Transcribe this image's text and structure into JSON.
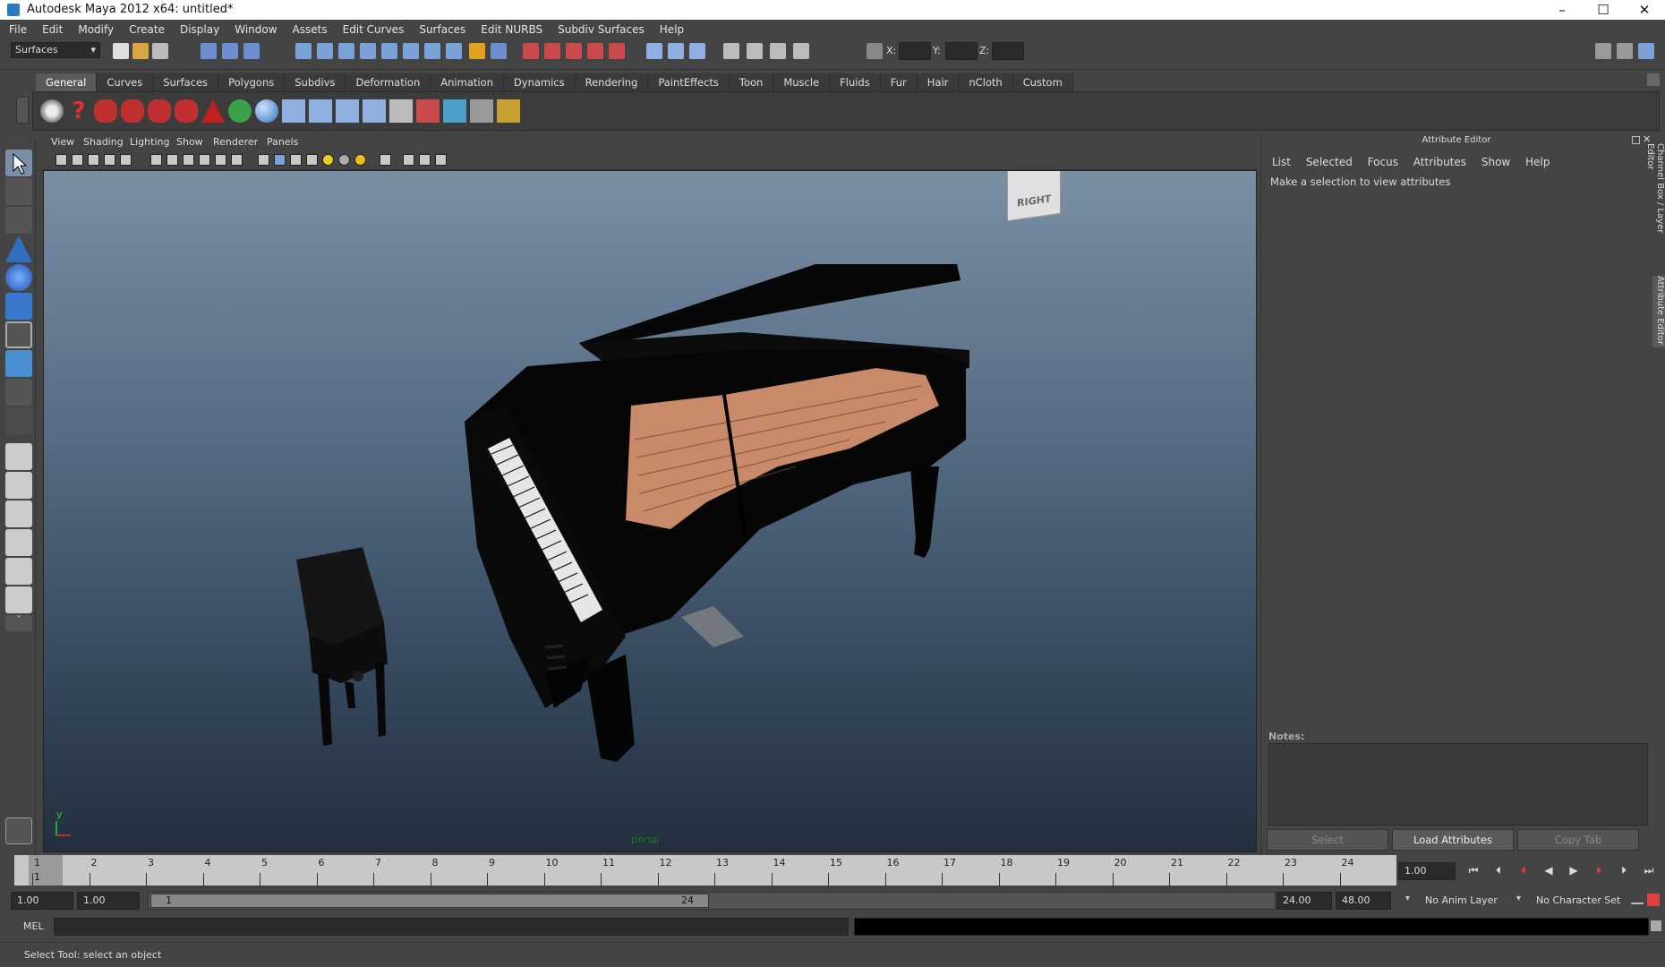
{
  "window": {
    "title": "Autodesk Maya 2012 x64: untitled*"
  },
  "menubar": [
    "File",
    "Edit",
    "Modify",
    "Create",
    "Display",
    "Window",
    "Assets",
    "Edit Curves",
    "Surfaces",
    "Edit NURBS",
    "Subdiv Surfaces",
    "Help"
  ],
  "statusline": {
    "menu_set": "Surfaces",
    "x_label": "X:",
    "y_label": "Y:",
    "z_label": "Z:"
  },
  "shelf": {
    "tabs": [
      "General",
      "Curves",
      "Surfaces",
      "Polygons",
      "Subdivs",
      "Deformation",
      "Animation",
      "Dynamics",
      "Rendering",
      "PaintEffects",
      "Toon",
      "Muscle",
      "Fluids",
      "Fur",
      "Hair",
      "nCloth",
      "Custom"
    ],
    "active_tab": "General"
  },
  "panel": {
    "menus": [
      "View",
      "Shading",
      "Lighting",
      "Show",
      "Renderer",
      "Panels"
    ],
    "camera_label": "persp",
    "viewcube_label": "RIGHT",
    "axis_y": "y"
  },
  "attribute_editor": {
    "title": "Attribute Editor",
    "menus": [
      "List",
      "Selected",
      "Focus",
      "Attributes",
      "Show",
      "Help"
    ],
    "hint": "Make a selection to view attributes",
    "notes_label": "Notes:",
    "buttons": {
      "select": "Select",
      "load": "Load Attributes",
      "copy": "Copy Tab"
    },
    "side_tabs": [
      "Channel Box / Layer Editor",
      "Attribute Editor"
    ]
  },
  "timeslider": {
    "ticks": [
      "1",
      "2",
      "3",
      "4",
      "5",
      "6",
      "7",
      "8",
      "9",
      "10",
      "11",
      "12",
      "13",
      "14",
      "15",
      "16",
      "17",
      "18",
      "19",
      "20",
      "21",
      "22",
      "23",
      "24"
    ],
    "current_frame": "1",
    "current_time": "1.00"
  },
  "rangeslider": {
    "start_time": "1.00",
    "playback_start": "1.00",
    "range_start_label": "1",
    "range_end_label": "24",
    "playback_end": "24.00",
    "end_time": "48.00",
    "anim_layer": "No Anim Layer",
    "character_set": "No Character Set"
  },
  "commandline": {
    "label": "MEL"
  },
  "helpline": {
    "text": "Select Tool: select an object"
  },
  "colors": {
    "bg": "#444444",
    "viewport_top": "#7a8ea4",
    "viewport_bottom": "#232f3e",
    "soundboard": "#c98a6a"
  }
}
